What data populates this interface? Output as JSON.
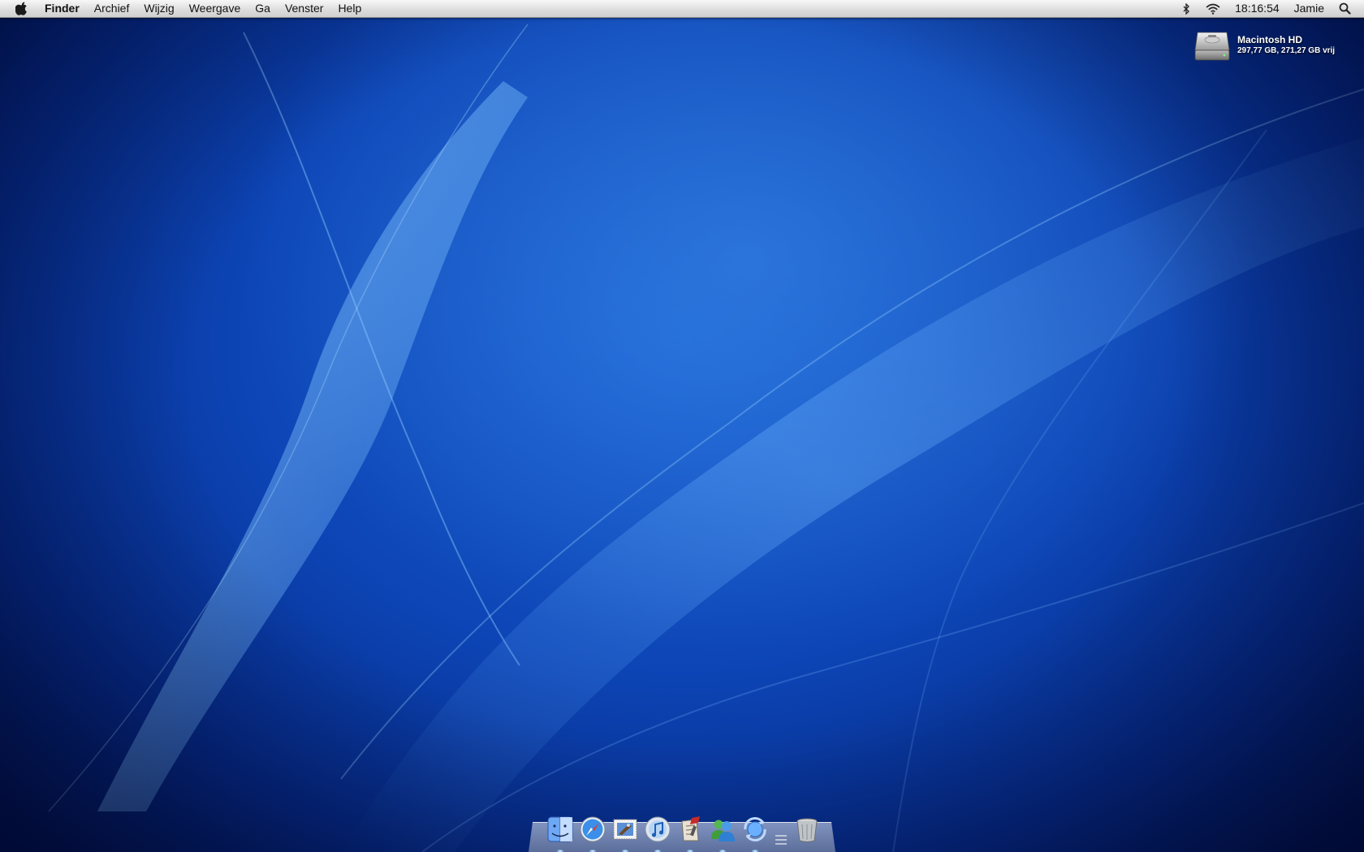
{
  "menubar": {
    "apple_icon": "apple-logo-icon",
    "app_name": "Finder",
    "menus": [
      "Archief",
      "Wijzig",
      "Weergave",
      "Ga",
      "Venster",
      "Help"
    ],
    "status": {
      "bluetooth_icon": "bluetooth-icon",
      "wifi_icon": "wifi-icon",
      "clock": "18:16:54",
      "user": "Jamie",
      "spotlight_icon": "spotlight-search-icon"
    }
  },
  "desktop": {
    "drive": {
      "name": "Macintosh HD",
      "info": "297,77 GB, 271,27 GB vrij",
      "icon": "hard-drive-icon"
    }
  },
  "dock": {
    "apps": [
      {
        "name": "Finder",
        "icon": "finder-icon",
        "running": true
      },
      {
        "name": "Safari",
        "icon": "safari-icon",
        "running": true
      },
      {
        "name": "Mail",
        "icon": "mail-icon",
        "running": true
      },
      {
        "name": "iTunes",
        "icon": "itunes-icon",
        "running": true
      },
      {
        "name": "Script Editor",
        "icon": "script-editor-icon",
        "running": true
      },
      {
        "name": "Messenger",
        "icon": "messenger-icon",
        "running": true
      },
      {
        "name": "Sync",
        "icon": "sync-icon",
        "running": true
      }
    ],
    "trash_icon": "trash-icon"
  },
  "colors": {
    "wallpaper_primary": "#1a5fd0",
    "wallpaper_dark": "#01154d",
    "menubar": "#dcdcdc"
  }
}
